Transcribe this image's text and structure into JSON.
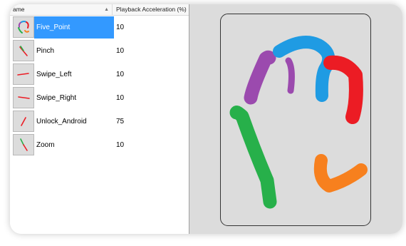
{
  "list": {
    "columns": {
      "name": "ame",
      "sort_icon": "sort-ascending-icon",
      "playback": "Playback Acceleration (%)"
    },
    "rows": [
      {
        "name": "Five_Point",
        "accel": "10",
        "icon": "five-point-gesture-icon",
        "selected": true
      },
      {
        "name": "Pinch",
        "accel": "10",
        "icon": "pinch-gesture-icon"
      },
      {
        "name": "Swipe_Left",
        "accel": "10",
        "icon": "swipe-left-gesture-icon"
      },
      {
        "name": "Swipe_Right",
        "accel": "10",
        "icon": "swipe-right-gesture-icon"
      },
      {
        "name": "Unlock_Android",
        "accel": "75",
        "icon": "unlock-gesture-icon"
      },
      {
        "name": "Zoom",
        "accel": "10",
        "icon": "zoom-gesture-icon"
      }
    ]
  },
  "preview": {
    "stroke_colors": {
      "green": "#27b04a",
      "purple": "#9b4aae",
      "blue": "#1f9be3",
      "red": "#ec1c24",
      "orange": "#f7801e"
    },
    "selection_color": "#3399ff"
  }
}
